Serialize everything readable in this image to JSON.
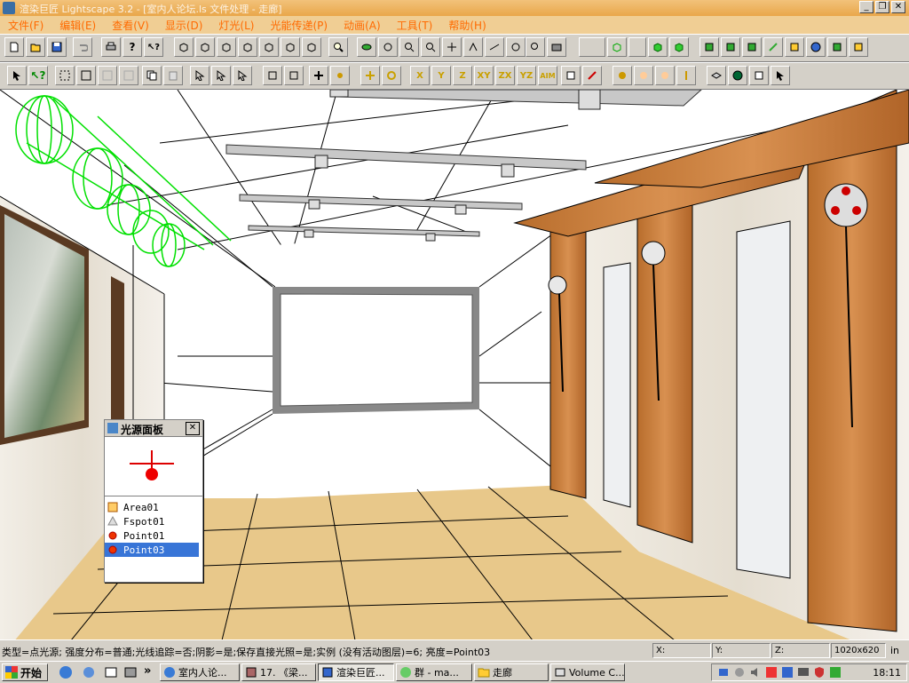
{
  "window": {
    "title": "渲染巨匠 Lightscape 3.2 - [室内人论坛.ls 文件处理 - 走廊]",
    "min_label": "_",
    "restore_label": "❐",
    "close_label": "✕"
  },
  "menu": [
    "文件(F)",
    "编辑(E)",
    "查看(V)",
    "显示(D)",
    "灯光(L)",
    "光能传递(P)",
    "动画(A)",
    "工具(T)",
    "帮助(H)"
  ],
  "toolbar2_axis_labels": [
    "X",
    "Y",
    "Z",
    "XY",
    "ZX",
    "YZ",
    "AIM"
  ],
  "light_panel": {
    "title": "光源面板",
    "close_label": "✕",
    "lights": [
      {
        "name": "Area01",
        "icon": "area-light-icon",
        "selected": false
      },
      {
        "name": "Fspot01",
        "icon": "spot-light-icon",
        "selected": false
      },
      {
        "name": "Point01",
        "icon": "point-light-icon",
        "selected": false
      },
      {
        "name": "Point03",
        "icon": "point-light-icon",
        "selected": true
      }
    ]
  },
  "status": {
    "text": "类型=点光源; 强度分布=普通;光线追踪=否;阴影=是;保存直接光照=是;实例 (没有活动图层)=6; 亮度=Point03",
    "x_label": "X:",
    "y_label": "Y:",
    "z_label": "Z:",
    "resolution": "1020x620",
    "unit": "in"
  },
  "taskbar": {
    "start_label": "开始",
    "more_label": "»",
    "tasks": [
      {
        "label": "室内人论...",
        "active": false,
        "icon": "ie-icon"
      },
      {
        "label": "17. 《梁...",
        "active": false,
        "icon": "app-icon"
      },
      {
        "label": "渲染巨匠...",
        "active": true,
        "icon": "render-icon"
      },
      {
        "label": "群 - ma...",
        "active": false,
        "icon": "chat-icon"
      },
      {
        "label": "走廊",
        "active": false,
        "icon": "folder-icon"
      },
      {
        "label": "Volume C...",
        "active": false,
        "icon": "volume-icon"
      }
    ],
    "clock": "18:11"
  },
  "colors": {
    "menu_text": "#ff6a00",
    "wireframe_green": "#00e000",
    "selection": "#3875d7",
    "wood": "#c8803a",
    "floor": "#e8c88a"
  }
}
